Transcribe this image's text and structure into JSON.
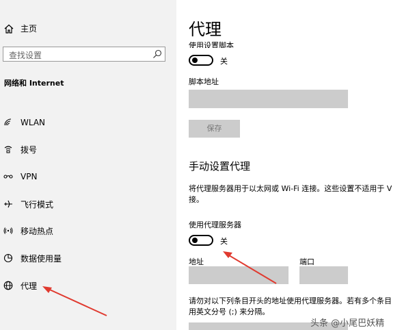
{
  "sidebar": {
    "home_label": "主页",
    "search_placeholder": "查找设置",
    "section_title": "网络和 Internet",
    "items": [
      {
        "label": "WLAN",
        "icon": "wifi-icon"
      },
      {
        "label": "拨号",
        "icon": "dialup-icon"
      },
      {
        "label": "VPN",
        "icon": "vpn-icon"
      },
      {
        "label": "飞行模式",
        "icon": "airplane-icon"
      },
      {
        "label": "移动热点",
        "icon": "hotspot-icon"
      },
      {
        "label": "数据使用量",
        "icon": "data-usage-icon"
      },
      {
        "label": "代理",
        "icon": "globe-icon"
      }
    ]
  },
  "main": {
    "title": "代理",
    "script_toggle_label": "使用设置脚本",
    "script_toggle_state": "关",
    "script_address_label": "脚本地址",
    "save_label": "保存",
    "manual_title": "手动设置代理",
    "manual_desc_line1": "将代理服务器用于以太网或 Wi-Fi 连接。这些设置不适用于 V",
    "manual_desc_line2": "接。",
    "use_proxy_label": "使用代理服务器",
    "use_proxy_state": "关",
    "address_label": "地址",
    "port_label": "端口",
    "exceptions_line1": "请勿对以下列条目开头的地址使用代理服务器。若有多个条目",
    "exceptions_line2": "用英文分号 (;) 来分隔。"
  },
  "watermark": "头条 @小尾巴妖精",
  "colors": {
    "sidebar_bg": "#f2f2f2",
    "field_bg": "#cccccc",
    "arrow": "#e03a2f"
  }
}
